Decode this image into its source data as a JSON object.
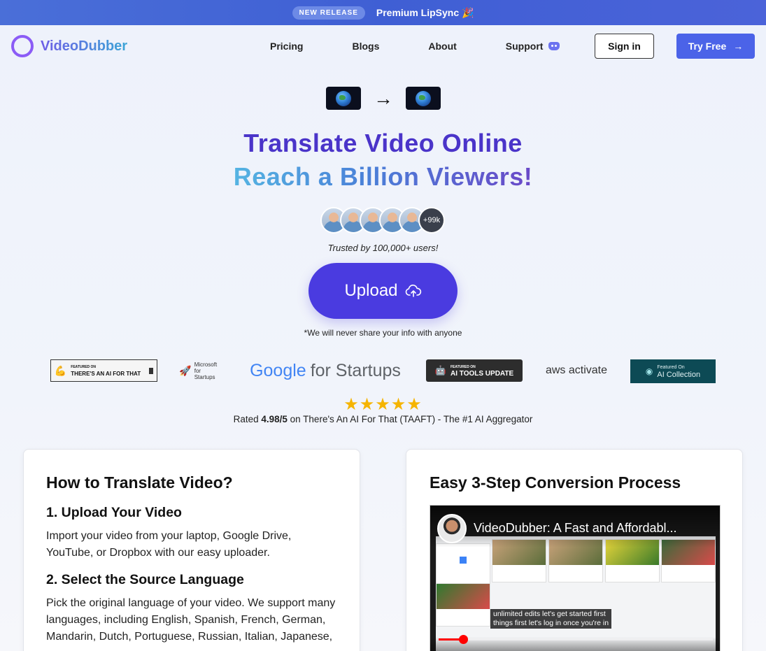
{
  "banner": {
    "badge": "NEW RELEASE",
    "text": "Premium LipSync 🎉"
  },
  "nav": {
    "logo": "VideoDubber",
    "links": [
      "Pricing",
      "Blogs",
      "About",
      "Support"
    ],
    "signin": "Sign in",
    "tryfree": "Try Free",
    "tryfree_icon": "→"
  },
  "hero": {
    "arrow": "→",
    "title_line1": "Translate Video Online",
    "title_line2": "Reach a Billion Viewers!",
    "avatars_more": "+99k",
    "trusted": "Trusted by 100,000+ users!",
    "upload_label": "Upload",
    "privacy": "*We will never share your info with anyone"
  },
  "featured_logos": {
    "taaft": "THERE'S AN AI FOR THAT",
    "taaft_small": "FEATURED ON",
    "microsoft": "Microsoft for Startups",
    "google": "Google",
    "google_suffix": "for Startups",
    "aitools_small": "FEATURED ON",
    "aitools": "AI TOOLS UPDATE",
    "aws": "aws activate",
    "aicollection_small": "Featured On",
    "aicollection": "AI Collection"
  },
  "rating": {
    "stars": "★★★★★",
    "prefix": "Rated ",
    "score": "4.98/5",
    "suffix": " on There's An AI For That (TAAFT) - The #1 AI Aggregator"
  },
  "how_to": {
    "heading": "How to Translate Video?",
    "step1_title": "1. Upload Your Video",
    "step1_text": "Import your video from your laptop, Google Drive, YouTube, or Dropbox with our easy uploader.",
    "step2_title": "2. Select the Source Language",
    "step2_text": "Pick the original language of your video. We support many languages, including English, Spanish, French, German, Mandarin, Dutch, Portuguese, Russian, Italian, Japanese,"
  },
  "process": {
    "heading": "Easy 3-Step Conversion Process",
    "video_title": "VideoDubber: A Fast and Affordabl...",
    "caption_line1": "unlimited edits let's get started first",
    "caption_line2": "things first let's log in once you're in",
    "progress": 0.09
  },
  "colors": {
    "accent": "#4a3be0",
    "banner": "#4a6fd8",
    "star": "#f5b400"
  }
}
